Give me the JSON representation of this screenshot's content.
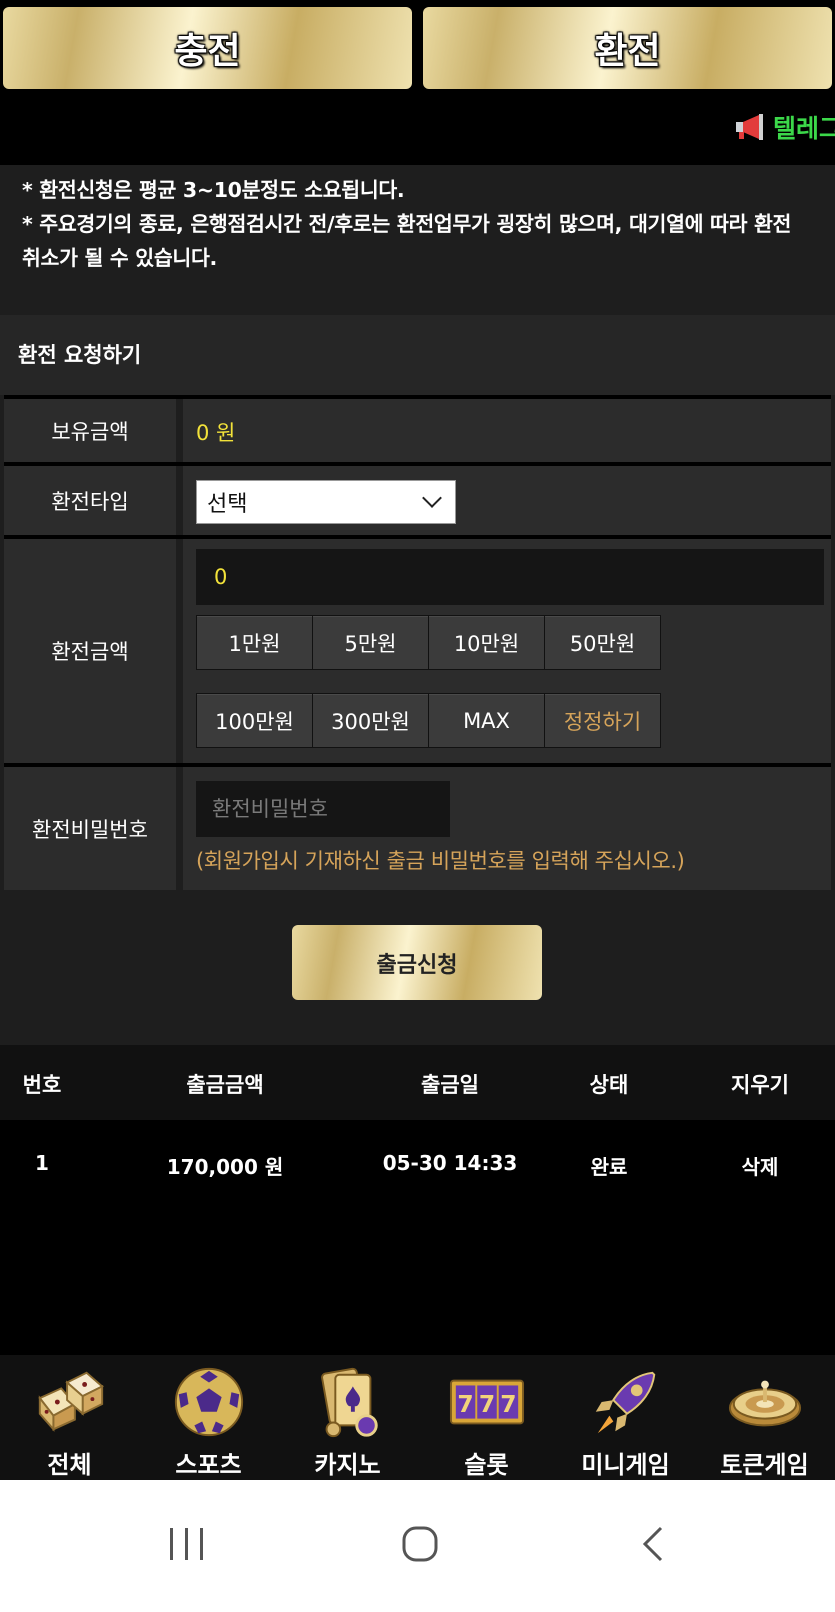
{
  "top_tabs": {
    "charge": "충전",
    "exchange": "환전"
  },
  "marquee": {
    "text": "텔레그"
  },
  "notice": {
    "line1": "* 환전신청은 평균 3~10분정도 소요됩니다.",
    "line2": "* 주요경기의 종료, 은행점검시간 전/후로는 환전업무가 굉장히 많으며, 대기열에 따라 환전 취소가 될 수 있습니다."
  },
  "section_title": "환전 요청하기",
  "form": {
    "balance_label": "보유금액",
    "balance_value": "0 원",
    "type_label": "환전타입",
    "type_selected": "선택",
    "amount_label": "환전금액",
    "amount_value": "0",
    "amount_buttons": [
      "1만원",
      "5만원",
      "10만원",
      "50만원",
      "100만원",
      "300만원",
      "MAX",
      "정정하기"
    ],
    "password_label": "환전비밀번호",
    "password_placeholder": "환전비밀번호",
    "password_hint": "(회원가입시 기재하신 출금 비밀번호를 입력해 주십시오.)"
  },
  "submit_label": "출금신청",
  "table": {
    "headers": [
      "번호",
      "출금금액",
      "출금일",
      "상태",
      "지우기"
    ],
    "rows": [
      [
        "1",
        "170,000 원",
        "05-30 14:33",
        "완료",
        "삭제"
      ]
    ]
  },
  "bottom_nav": [
    {
      "label": "전체",
      "icon": "dice-icon"
    },
    {
      "label": "스포츠",
      "icon": "soccer-ball-icon"
    },
    {
      "label": "카지노",
      "icon": "playing-cards-icon"
    },
    {
      "label": "슬롯",
      "icon": "slot-777-icon"
    },
    {
      "label": "미니게임",
      "icon": "rocket-icon"
    },
    {
      "label": "토큰게임",
      "icon": "roulette-icon"
    }
  ],
  "colors": {
    "gold": "#d9c47f",
    "marquee_green": "#3cd84a",
    "balance_yellow": "#f2e23a",
    "hint_orange": "#d6a45a"
  }
}
